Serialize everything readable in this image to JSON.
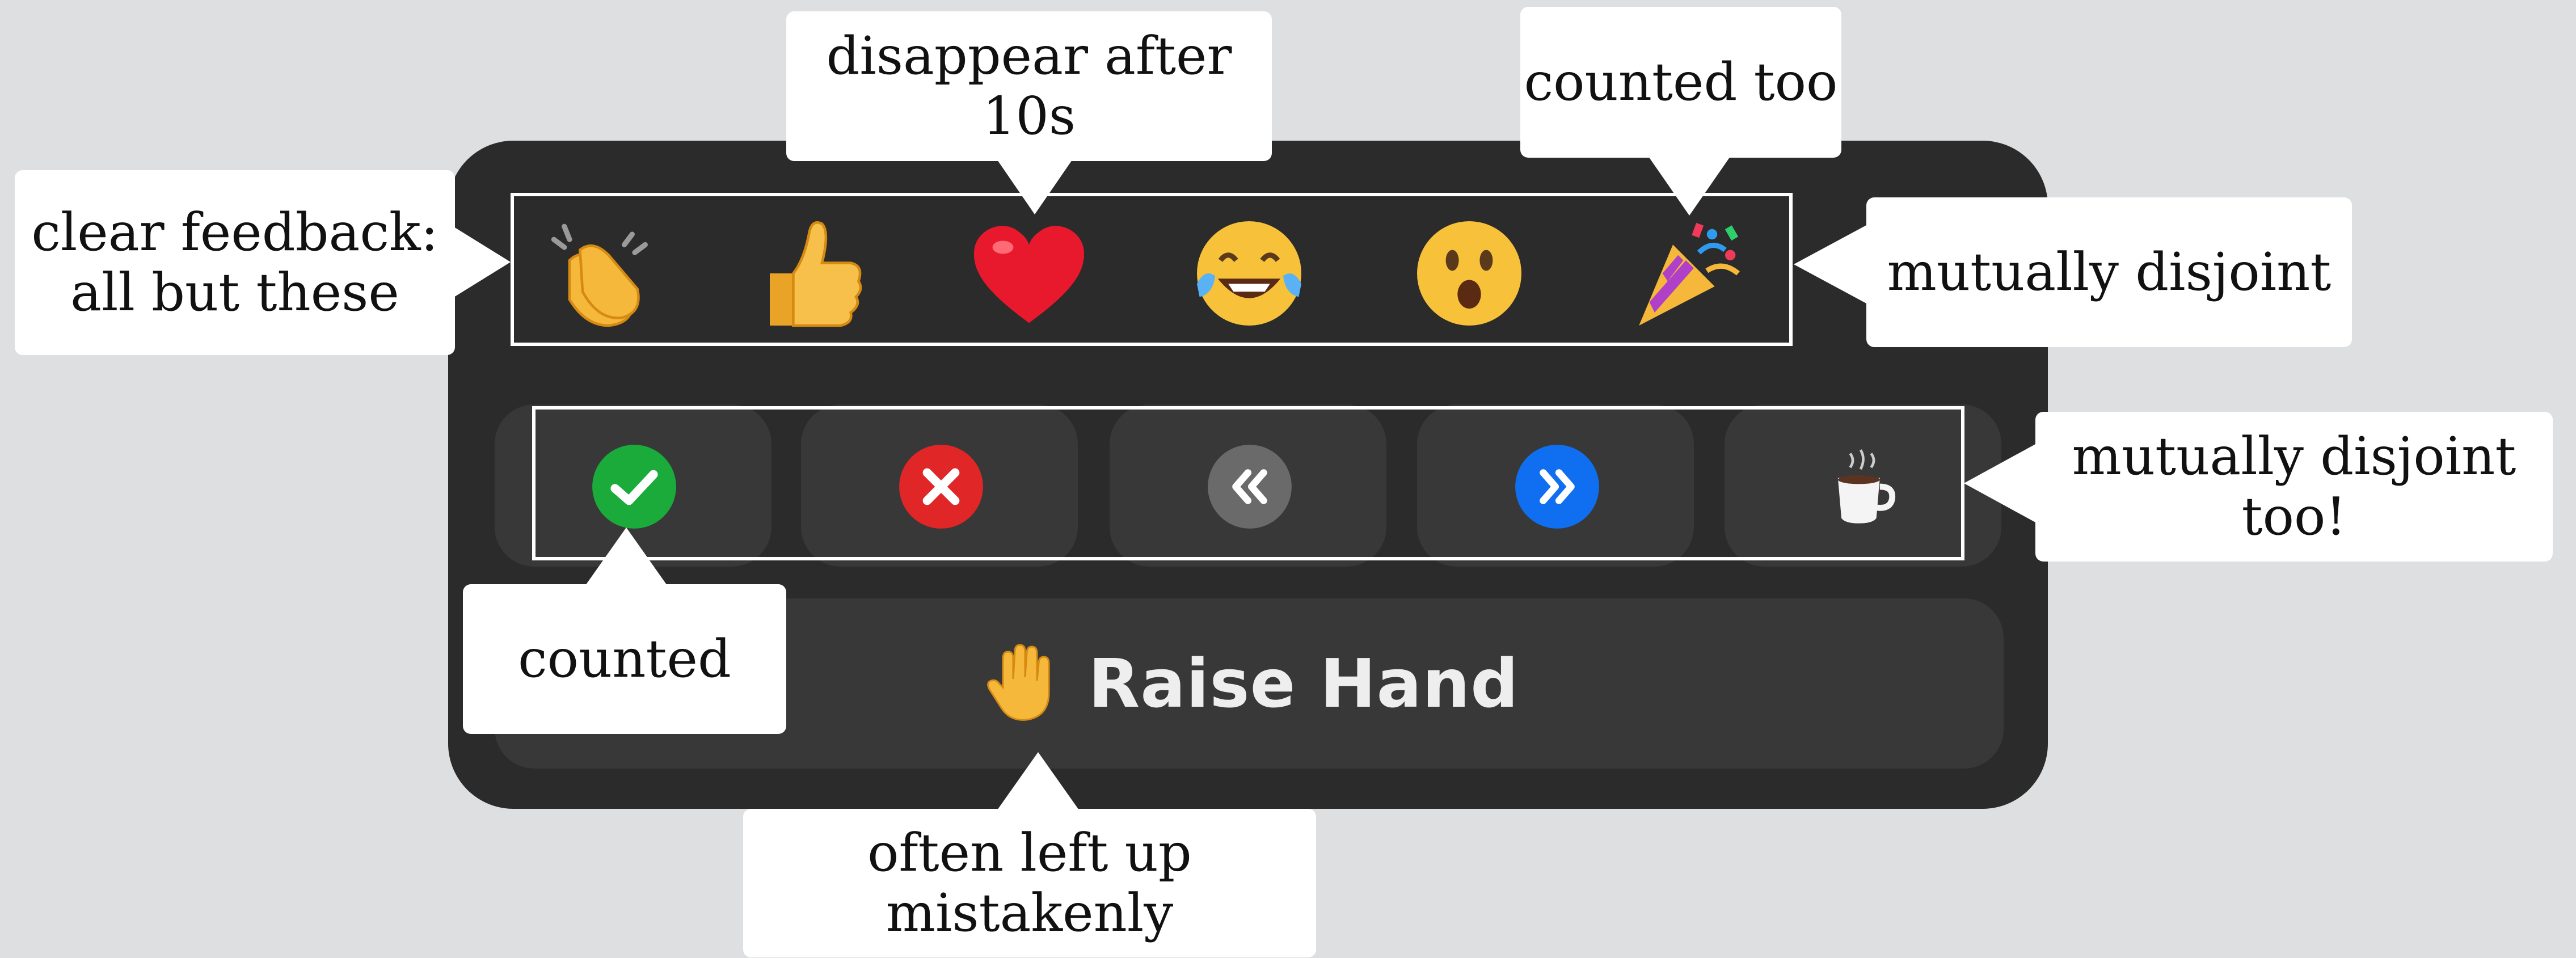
{
  "reactions": {
    "items": [
      {
        "name": "clapping-hands-icon"
      },
      {
        "name": "thumbs-up-icon"
      },
      {
        "name": "red-heart-icon"
      },
      {
        "name": "tears-of-joy-icon"
      },
      {
        "name": "surprised-face-icon"
      },
      {
        "name": "party-popper-icon"
      }
    ]
  },
  "status_buttons": {
    "items": [
      {
        "name": "yes-check-icon",
        "color": "#1aab3a"
      },
      {
        "name": "no-x-icon",
        "color": "#e02626"
      },
      {
        "name": "slow-down-icon",
        "color": "#6a6a6a"
      },
      {
        "name": "speed-up-icon",
        "color": "#0f6ff0"
      },
      {
        "name": "coffee-break-icon",
        "color": "#ffffff"
      }
    ]
  },
  "raise_hand": {
    "label": "Raise Hand",
    "icon": "raised-hand-icon"
  },
  "callouts": {
    "clear_feedback": {
      "line1": "clear feedback:",
      "line2": "all but these"
    },
    "disappear": "disappear after 10s",
    "counted_too": "counted too",
    "mutually_disjoint": "mutually disjoint",
    "mutually_disjoint_too": "mutually disjoint too!",
    "counted": "counted",
    "often_left_up": "often left up mistakenly"
  },
  "colors": {
    "background": "#dedfe0",
    "panel": "#2b2b2b",
    "tile": "#383838",
    "callout": "#ffffff"
  }
}
